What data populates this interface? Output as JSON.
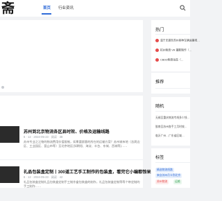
{
  "header": {
    "logo_text": "斋",
    "nav": [
      {
        "label": "首页"
      },
      {
        "label": "行业资讯"
      }
    ]
  },
  "articles": [
    {
      "title": "苏州到北京物流各区县时效、价格及运输线路",
      "meta": "6 · 12 · 2024-05-23 · 阅读 · 38",
      "text": "苏州专业之江物的物流费用价值限制，如果要顾客的所在的运输方案？苏州城市地（含周边区、工业园区、昆山市等）至北京地区(如朝阳、海淀、丰台、东城、西城等)……"
    },
    {
      "title": "礼品包装盒定制丨300道工艺手工制作的包装盒，看完它小编都惊呆",
      "meta": "6 · 12 · 2024-05-23 · 阅读 · 42",
      "text": "礼品包装盒定制礼品包装盒定制手工制作盒包装盒的制作，礼品包装盒定制等等个带定制的手工制作……"
    }
  ],
  "sidebar": {
    "hot_title": "热门",
    "hot_items": [
      "温于无锡至苏州各种车辆运输线…",
      "杭州物流 VR 摄影制作（…",
      "CBDD物流动态（…"
    ],
    "recommend_title": "推荐",
    "random_title": "随机",
    "random_items": [
      "无锡至重庆物流专线多少钱…",
      "胶南至苏州各手工月时效…",
      "临沂广州…广东省区域…"
    ],
    "tags_title": "标签",
    "tags": [
      {
        "label": "精选物流线路",
        "color": "#2f6bd8"
      },
      {
        "label": "来自苏州月卡到北京",
        "color": "#2f6bd8"
      },
      {
        "label": "苏州物流",
        "color": "#e54b4b"
      },
      {
        "label": "运输",
        "color": "#3aa55a"
      }
    ]
  }
}
